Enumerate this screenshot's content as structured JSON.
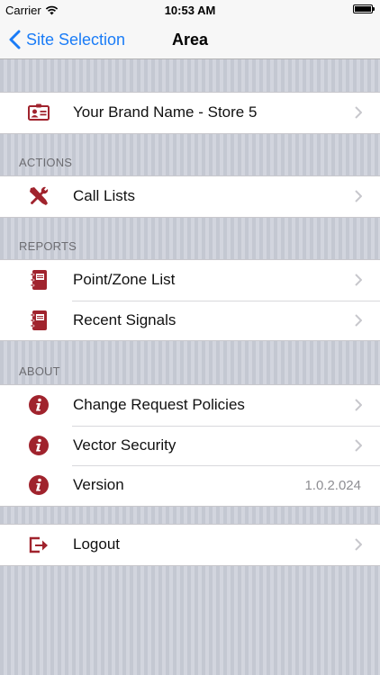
{
  "status_bar": {
    "carrier": "Carrier",
    "time": "10:53 AM"
  },
  "navbar": {
    "back_label": "Site Selection",
    "title": "Area"
  },
  "site": {
    "label": "Your Brand Name - Store 5",
    "icon": "id-card-icon"
  },
  "sections": {
    "actions": {
      "header": "ACTIONS",
      "items": [
        {
          "label": "Call Lists",
          "icon": "tools-icon"
        }
      ]
    },
    "reports": {
      "header": "REPORTS",
      "items": [
        {
          "label": "Point/Zone List",
          "icon": "notebook-icon"
        },
        {
          "label": "Recent Signals",
          "icon": "notebook-icon"
        }
      ]
    },
    "about": {
      "header": "ABOUT",
      "items": [
        {
          "label": "Change Request Policies",
          "icon": "info-icon"
        },
        {
          "label": "Vector Security",
          "icon": "info-icon"
        },
        {
          "label": "Version",
          "value": "1.0.2.024",
          "icon": "info-icon"
        }
      ]
    }
  },
  "logout": {
    "label": "Logout",
    "icon": "logout-icon"
  },
  "colors": {
    "accent": "#1a7cf7",
    "icon_red": "#a0232d",
    "chevron": "#c7c7cc"
  }
}
